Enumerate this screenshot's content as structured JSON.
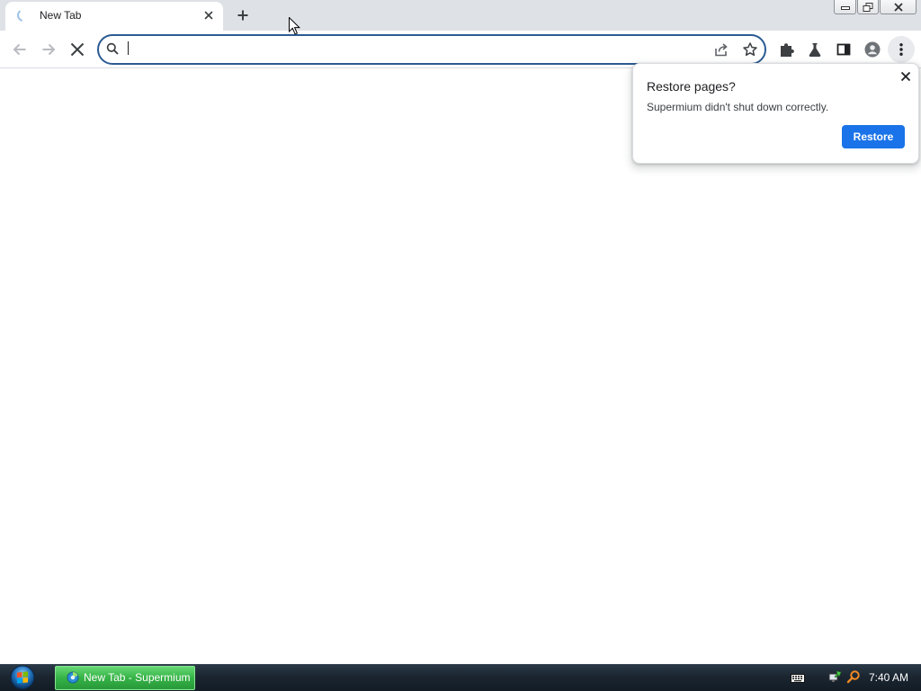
{
  "window_controls": {
    "minimize_icon": "minimize-icon",
    "restore_icon": "restore-window-icon",
    "close_icon": "close-icon"
  },
  "tab_strip": {
    "tabs": [
      {
        "title": "New Tab",
        "favicon": "loading-spinner-icon",
        "close_icon": "close-icon",
        "active": true
      }
    ],
    "new_tab_icon": "plus-icon"
  },
  "toolbar": {
    "back": {
      "icon": "back-arrow-icon",
      "enabled": false
    },
    "forward": {
      "icon": "forward-arrow-icon",
      "enabled": false
    },
    "stop": {
      "icon": "stop-icon"
    },
    "omnibox": {
      "value": "",
      "search_icon": "search-icon",
      "share_icon": "share-icon",
      "bookmark_icon": "star-icon"
    },
    "actions": [
      "puzzle-icon",
      "flask-icon",
      "side-panel-icon",
      "profile-icon",
      "more-menu-icon"
    ]
  },
  "restore_bubble": {
    "title": "Restore pages?",
    "message": "Supermium didn't shut down correctly.",
    "button_label": "Restore",
    "close_icon": "close-icon"
  },
  "taskbar": {
    "start_icon": "windows-start-icon",
    "task": {
      "label": "New Tab - Supermium",
      "icon": "supermium-icon",
      "active": true
    },
    "tray": {
      "keyboard_icon": "keyboard-icon",
      "network_icon": "network-icon",
      "search_icon": "search-icon",
      "clock": "7:40 AM"
    }
  },
  "colors": {
    "tab_strip_bg": "#dee1e6",
    "omnibox_border": "#2b5b93",
    "accent": "#1a73e8",
    "taskbar_bg": "#1b2631",
    "taskbar_task_bg": "#35b346",
    "text_primary": "#202124",
    "icon_default": "#5f6368",
    "icon_disabled": "#b8bbbf"
  }
}
